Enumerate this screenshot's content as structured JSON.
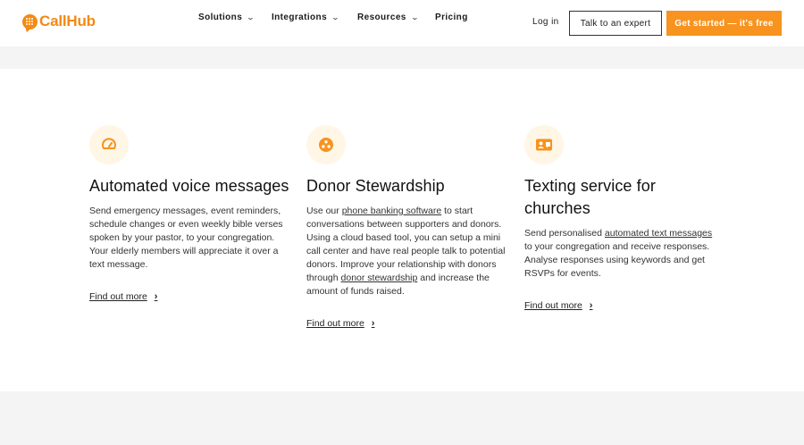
{
  "brand": {
    "name": "CallHub",
    "color": "#f28a14"
  },
  "nav": {
    "items": [
      {
        "label": "Solutions",
        "has_dropdown": true
      },
      {
        "label": "Integrations",
        "has_dropdown": true
      },
      {
        "label": "Resources",
        "has_dropdown": true
      },
      {
        "label": "Pricing",
        "has_dropdown": false
      }
    ],
    "login_label": "Log in",
    "expert_label": "Talk to an expert",
    "cta_label": "Get started — it's free",
    "cta_color": "#f7931e"
  },
  "features": [
    {
      "icon": "speedometer-icon",
      "title": "Automated voice messages",
      "description": "Send emergency messages, event reminders, schedule changes or even weekly bible verses spoken by your pastor, to your congregation. Your elderly members will appreciate it over a text message.",
      "link_label": "Find out more"
    },
    {
      "icon": "donor-group-icon",
      "title": "Donor Stewardship",
      "desc_part1": "Use our ",
      "desc_link1": "phone banking software",
      "desc_part2": " to start conversations between supporters and donors. Using a cloud based tool, you can setup a mini call center and have real people talk to potential donors. Improve your relationship with donors through ",
      "desc_link2": "donor stewardship",
      "desc_part3": " and increase the amount of funds raised.",
      "link_label": "Find out more"
    },
    {
      "icon": "text-message-card-icon",
      "title": "Texting service for churches",
      "desc_part1": "Send personalised ",
      "desc_link1": "automated text messages",
      "desc_part2": " to your congregation and receive responses. Analyse responses using keywords and get RSVPs for events.",
      "link_label": "Find out more"
    }
  ],
  "icon_color": "#f7931e",
  "icon_bg": "#fff6e6"
}
